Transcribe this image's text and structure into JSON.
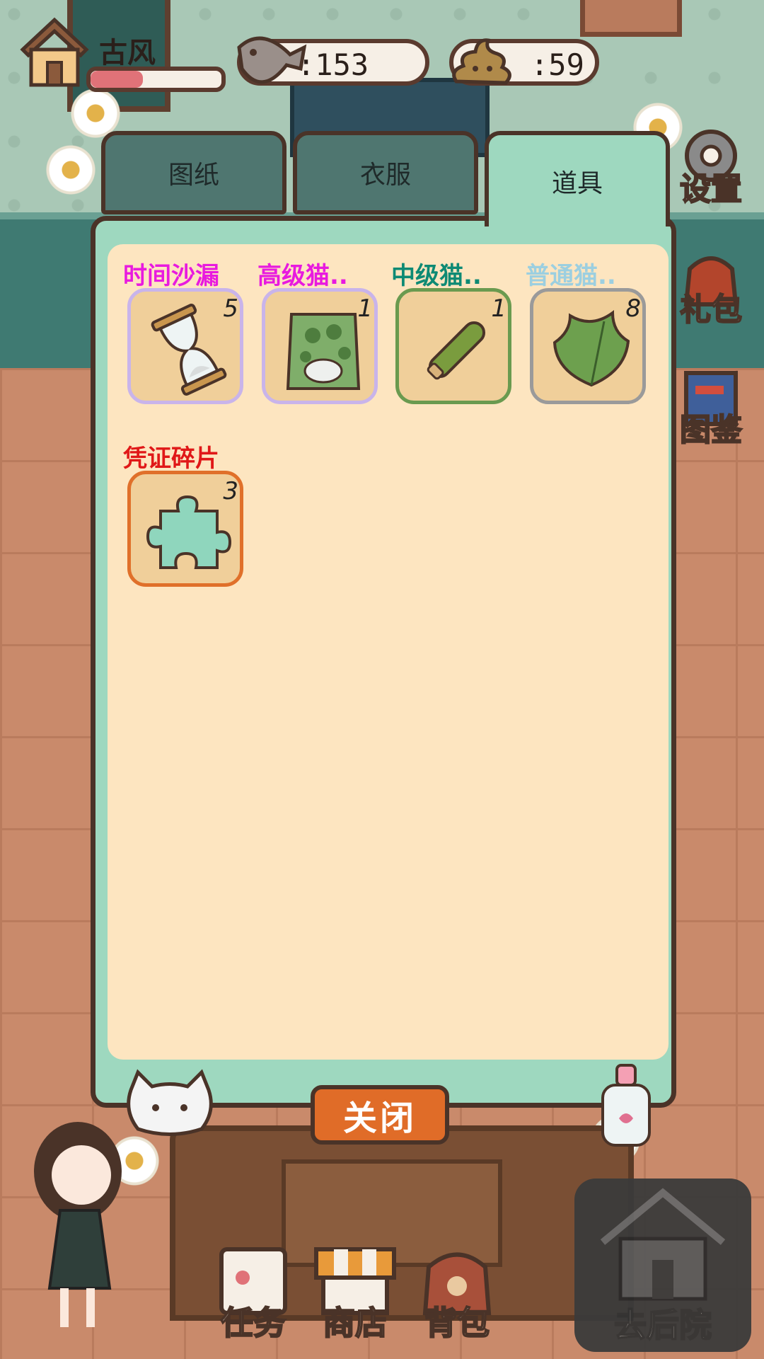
{
  "hud": {
    "username": "古风",
    "level_progress": 0.4,
    "fish_count": ":153",
    "poop_count": ":59"
  },
  "side_buttons": [
    {
      "label": "设置",
      "icon": "gear-icon"
    },
    {
      "label": "礼包",
      "icon": "gift-bag-icon"
    },
    {
      "label": "图鉴",
      "icon": "book-icon"
    }
  ],
  "tabs": [
    {
      "label": "图纸",
      "active": false
    },
    {
      "label": "衣服",
      "active": false
    },
    {
      "label": "道具",
      "active": true
    }
  ],
  "items": [
    {
      "name": "时间沙漏",
      "count": "5",
      "name_color": "#e81adf",
      "border_color": "#c9b4ea",
      "icon": "hourglass-icon"
    },
    {
      "name": "高级猫..",
      "count": "1",
      "name_color": "#e81adf",
      "border_color": "#c9b4ea",
      "icon": "cat-food-bag-icon"
    },
    {
      "name": "中级猫..",
      "count": "1",
      "name_color": "#0e8a74",
      "border_color": "#6a9a4f",
      "icon": "cucumber-icon"
    },
    {
      "name": "普通猫..",
      "count": "8",
      "name_color": "#9ccfe0",
      "border_color": "#9a9a9a",
      "icon": "leaf-icon"
    },
    {
      "name": "凭证碎片",
      "count": "3",
      "name_color": "#e01818",
      "border_color": "#e0702a",
      "icon": "puzzle-piece-icon"
    }
  ],
  "close_label": "关闭",
  "nav": {
    "task": "任务",
    "shop": "商店",
    "bag": "背包",
    "backyard": "去后院"
  }
}
